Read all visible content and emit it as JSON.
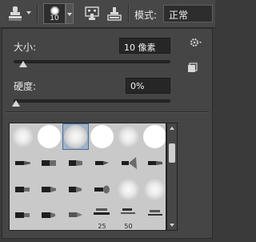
{
  "toolbar": {
    "brush_size": "10",
    "mode_label": "模式:",
    "mode_value": "正常",
    "icons": [
      "clone-stamp-tool-icon",
      "brush-panel-toggle-icon",
      "clone-source-panel-icon"
    ]
  },
  "panel": {
    "size_label": "大小:",
    "size_value": "10 像素",
    "size_slider_fraction": 0.02,
    "hardness_label": "硬度:",
    "hardness_value": "0%",
    "hardness_slider_fraction": 0.0
  },
  "brush_grid": {
    "rows": [
      [
        "round-soft",
        "round-hard",
        "round-soft-selected",
        "round-hard",
        "round-soft",
        "round-hard"
      ],
      [
        "bristle",
        "bristle",
        "bristle",
        "bristle",
        "fan-bristle",
        "bristle"
      ],
      [
        "bristle",
        "bristle",
        "bristle",
        "airbrush",
        "round-soft",
        "round-soft"
      ],
      [
        "bristle",
        "bristle",
        "bristle",
        "sampled",
        "sampled",
        "sampled"
      ]
    ],
    "captions": [
      "25",
      "50"
    ]
  },
  "colors": {
    "panel_bg": "#454545",
    "grid_bg": "#c9c9c9",
    "selection": "#9fb2c8"
  }
}
